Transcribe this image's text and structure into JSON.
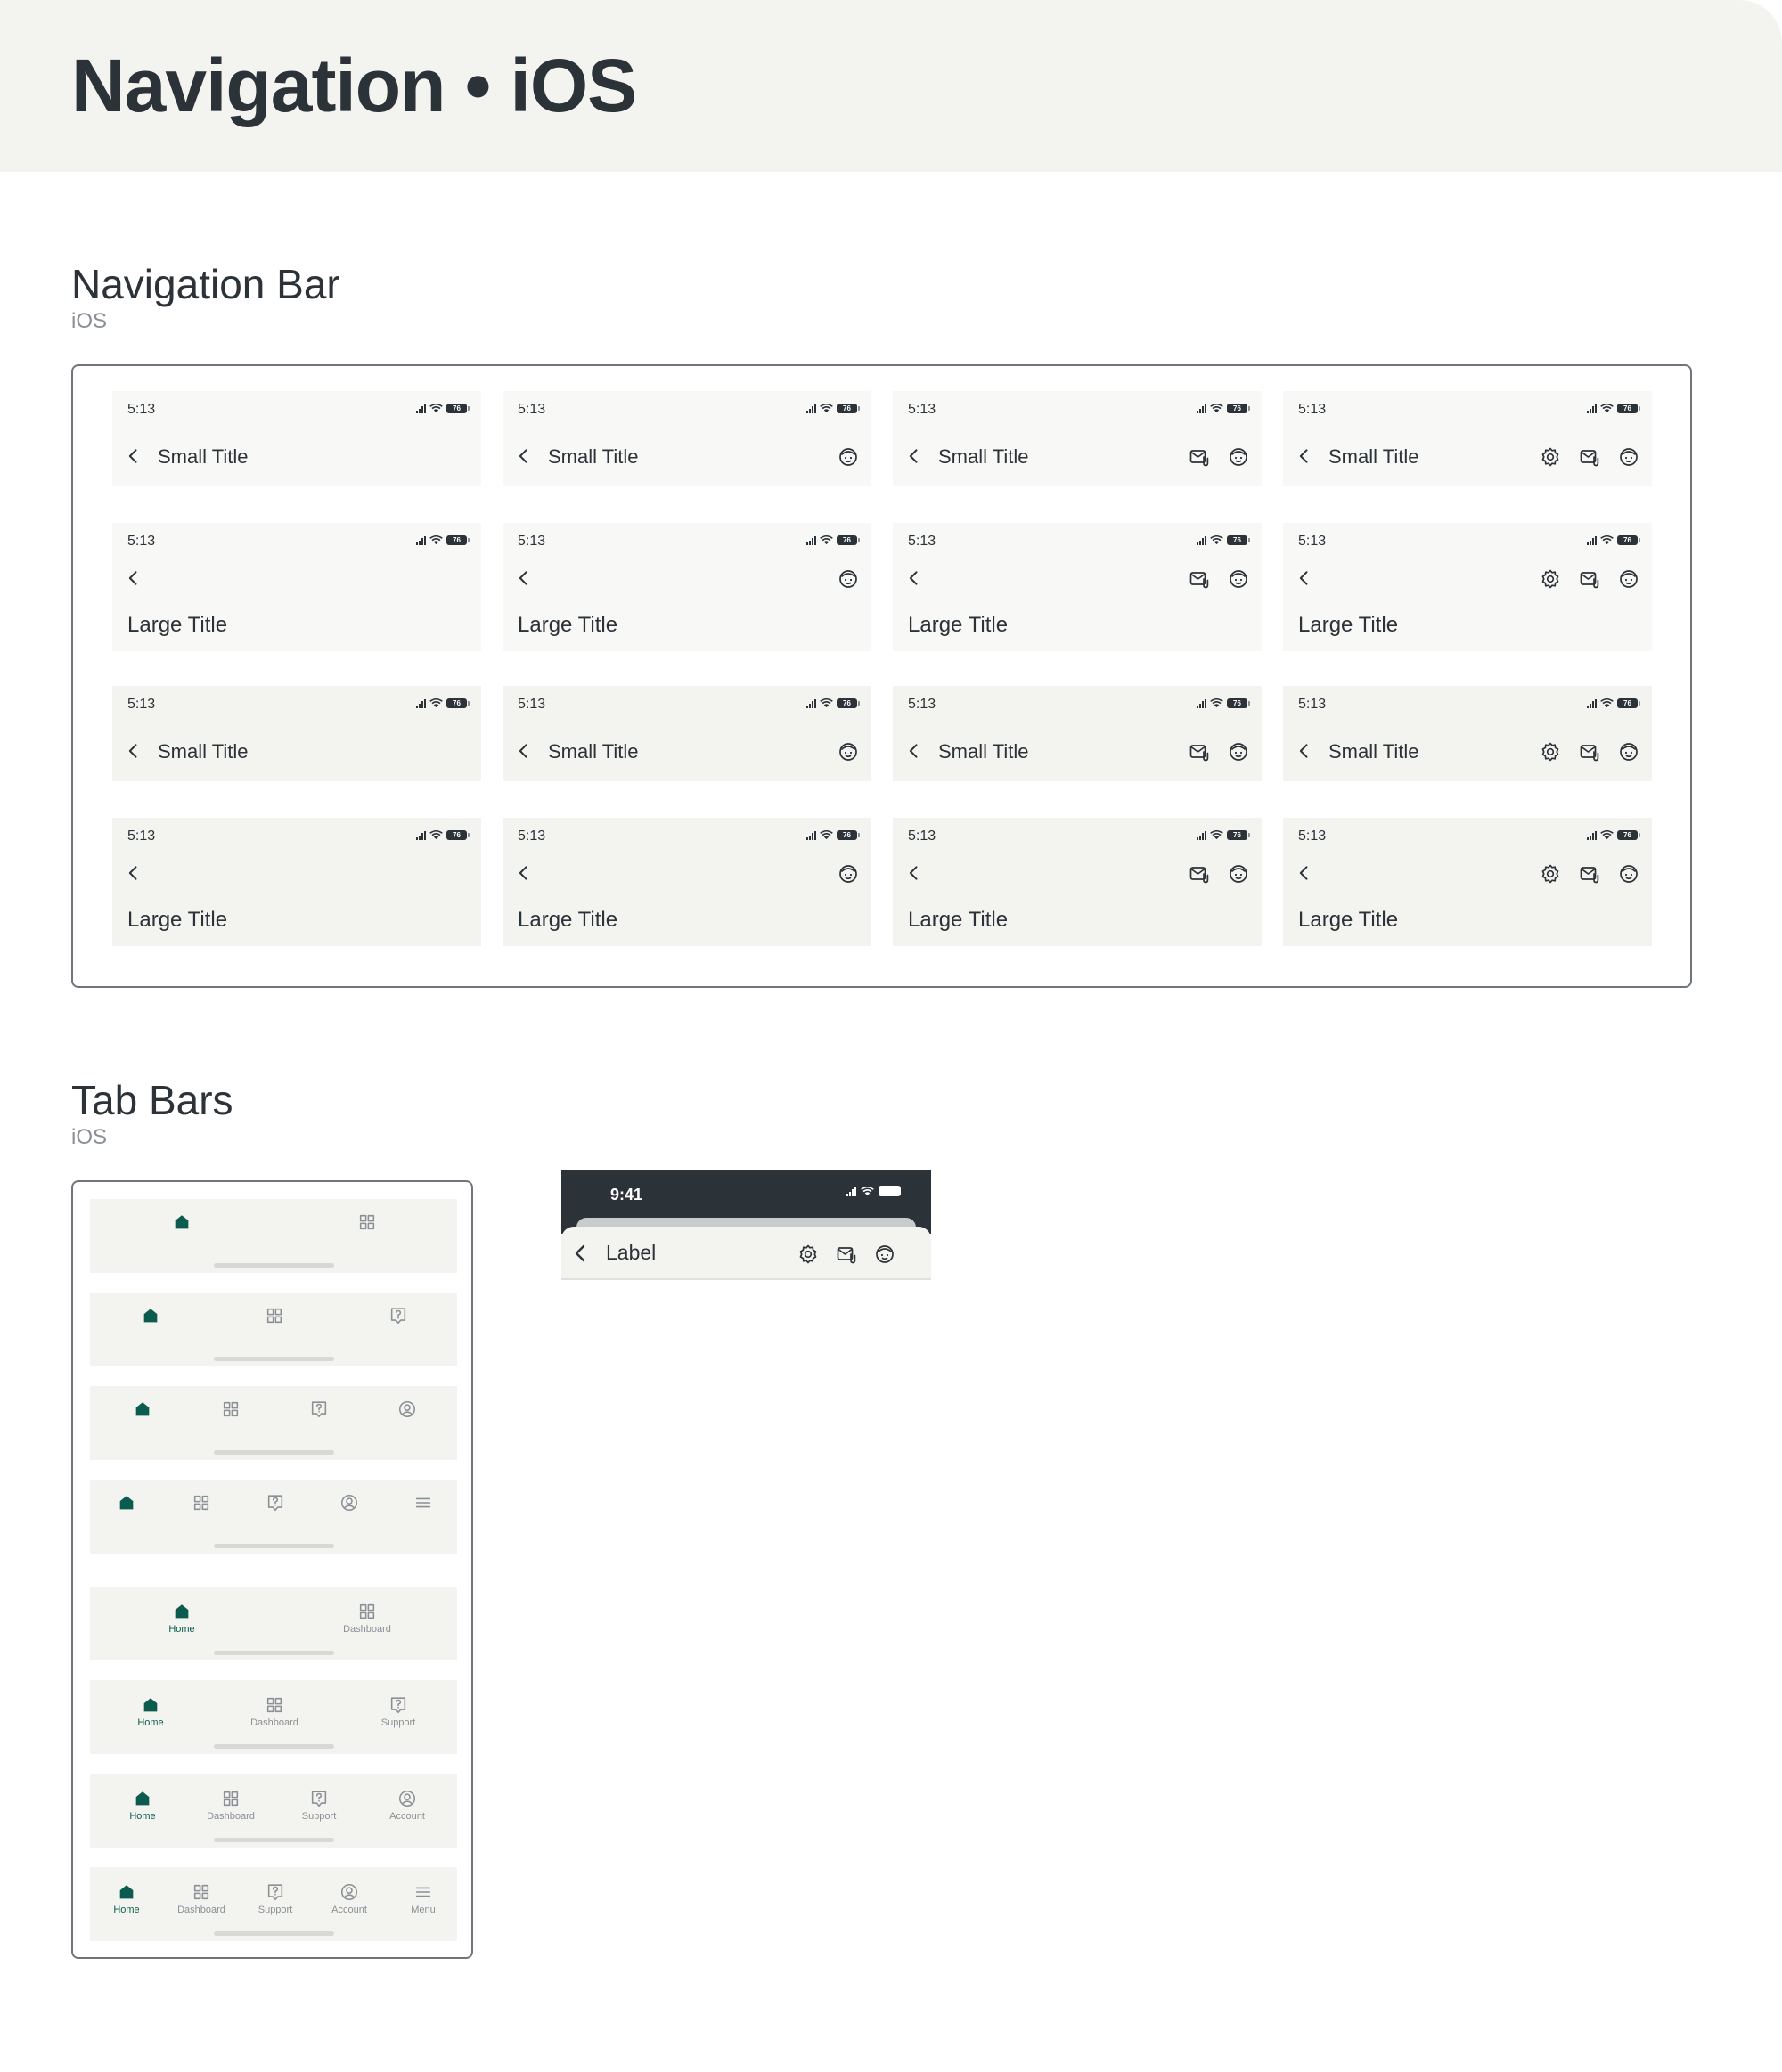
{
  "page": {
    "title": "Navigation • iOS"
  },
  "nav_section": {
    "title": "Navigation Bar",
    "subtitle": "iOS"
  },
  "tab_section": {
    "title": "Tab Bars",
    "subtitle": "iOS"
  },
  "status_bar": {
    "time": "5:13",
    "battery": "76"
  },
  "nav_titles": {
    "small": "Small Title",
    "large": "Large Title"
  },
  "nav_icons": {
    "back": "chevron-left-icon",
    "face": "face-icon",
    "mail": "mail-attachment-icon",
    "settings": "gear-icon"
  },
  "tabs": [
    {
      "label": "Home",
      "icon": "home-icon",
      "active": true
    },
    {
      "label": "Dashboard",
      "icon": "dashboard-grid-icon"
    },
    {
      "label": "Support",
      "icon": "help-icon"
    },
    {
      "label": "Account",
      "icon": "account-circle-icon"
    },
    {
      "label": "Menu",
      "icon": "menu-icon"
    }
  ],
  "preview": {
    "time": "9:41",
    "label": "Label"
  },
  "colors": {
    "accent": "#0b5c4f",
    "text": "#2b3238",
    "surface": "#f3f3ef",
    "muted": "#8a9096",
    "dark_status": "#2b3238"
  }
}
